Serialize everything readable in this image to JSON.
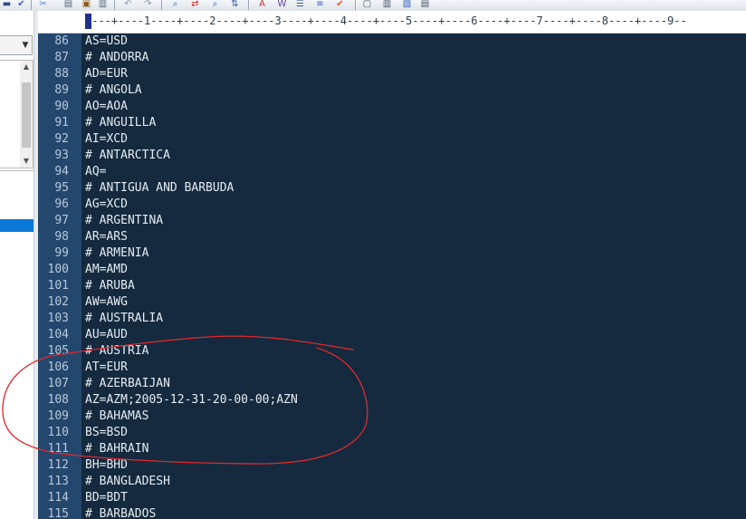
{
  "ruler": {
    "text": "----+----1----+----2----+----3----+----4----+----5----+----6----+----7----+----8----+----9--"
  },
  "editor": {
    "lines": [
      {
        "n": "86",
        "t": "AS=USD"
      },
      {
        "n": "87",
        "t": "# ANDORRA"
      },
      {
        "n": "88",
        "t": "AD=EUR"
      },
      {
        "n": "89",
        "t": "# ANGOLA"
      },
      {
        "n": "90",
        "t": "AO=AOA"
      },
      {
        "n": "91",
        "t": "# ANGUILLA"
      },
      {
        "n": "92",
        "t": "AI=XCD"
      },
      {
        "n": "93",
        "t": "# ANTARCTICA"
      },
      {
        "n": "94",
        "t": "AQ="
      },
      {
        "n": "95",
        "t": "# ANTIGUA AND BARBUDA"
      },
      {
        "n": "96",
        "t": "AG=XCD"
      },
      {
        "n": "97",
        "t": "# ARGENTINA"
      },
      {
        "n": "98",
        "t": "AR=ARS"
      },
      {
        "n": "99",
        "t": "# ARMENIA"
      },
      {
        "n": "100",
        "t": "AM=AMD"
      },
      {
        "n": "101",
        "t": "# ARUBA"
      },
      {
        "n": "102",
        "t": "AW=AWG"
      },
      {
        "n": "103",
        "t": "# AUSTRALIA"
      },
      {
        "n": "104",
        "t": "AU=AUD"
      },
      {
        "n": "105",
        "t": "# AUSTRIA"
      },
      {
        "n": "106",
        "t": "AT=EUR"
      },
      {
        "n": "107",
        "t": "# AZERBAIJAN"
      },
      {
        "n": "108",
        "t": "AZ=AZM;2005-12-31-20-00-00;AZN"
      },
      {
        "n": "109",
        "t": "# BAHAMAS"
      },
      {
        "n": "110",
        "t": "BS=BSD"
      },
      {
        "n": "111",
        "t": "# BAHRAIN"
      },
      {
        "n": "112",
        "t": "BH=BHD"
      },
      {
        "n": "113",
        "t": "# BANGLADESH"
      },
      {
        "n": "114",
        "t": "BD=BDT"
      },
      {
        "n": "115",
        "t": "# BARBADOS"
      }
    ]
  },
  "colors": {
    "editor_bg": "#152a3e",
    "gutter_bg": "#24476e",
    "text": "#e4ecf3",
    "line_number": "#b7c8da",
    "annotation": "#e0282d",
    "selection": "#0a78d7"
  },
  "toolbar": {
    "icons": [
      "save-icon",
      "check-icon",
      "clip-icon",
      "copy-icon",
      "paste-icon",
      "undo-icon",
      "redo-icon",
      "find-icon",
      "replace-icon",
      "find-in-files-icon",
      "sort-icon",
      "font-icon",
      "word-wrap-icon",
      "indent-icon",
      "abc-icon",
      "spell-check-icon",
      "window-icon",
      "split-icon",
      "compare-icon",
      "doc-icon"
    ]
  }
}
